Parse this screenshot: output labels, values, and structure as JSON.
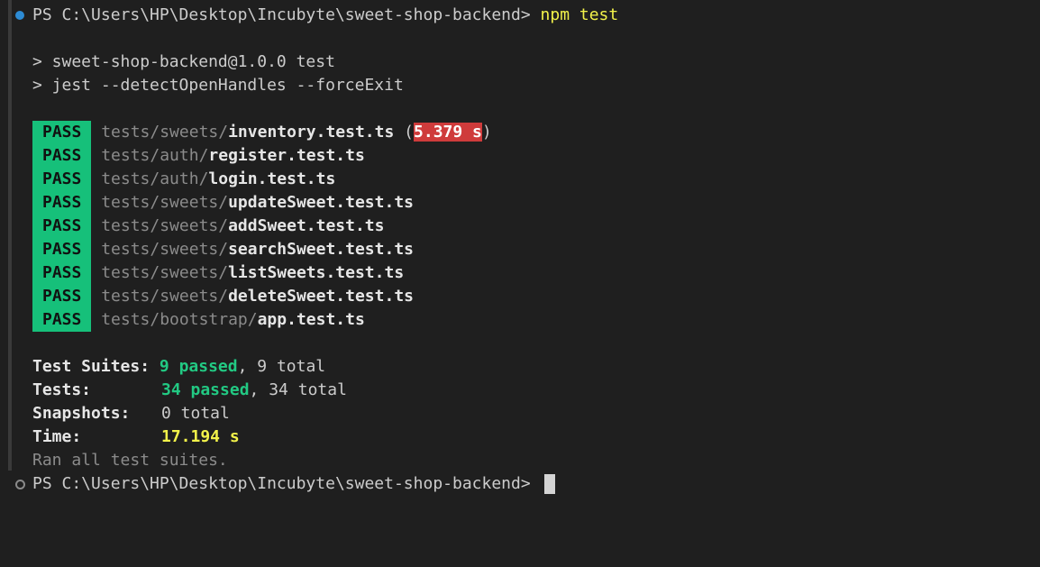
{
  "prompt1": {
    "path": "PS C:\\Users\\HP\\Desktop\\Incubyte\\sweet-shop-backend>",
    "command": "npm test"
  },
  "script_lines": [
    "> sweet-shop-backend@1.0.0 test",
    "> jest --detectOpenHandles --forceExit"
  ],
  "results": [
    {
      "status": "PASS",
      "dir": "tests/sweets/",
      "file": "inventory.test.ts",
      "open": " (",
      "time": "5.379 s",
      "close": ")"
    },
    {
      "status": "PASS",
      "dir": "tests/auth/",
      "file": "register.test.ts"
    },
    {
      "status": "PASS",
      "dir": "tests/auth/",
      "file": "login.test.ts"
    },
    {
      "status": "PASS",
      "dir": "tests/sweets/",
      "file": "updateSweet.test.ts"
    },
    {
      "status": "PASS",
      "dir": "tests/sweets/",
      "file": "addSweet.test.ts"
    },
    {
      "status": "PASS",
      "dir": "tests/sweets/",
      "file": "searchSweet.test.ts"
    },
    {
      "status": "PASS",
      "dir": "tests/sweets/",
      "file": "listSweets.test.ts"
    },
    {
      "status": "PASS",
      "dir": "tests/sweets/",
      "file": "deleteSweet.test.ts"
    },
    {
      "status": "PASS",
      "dir": "tests/bootstrap/",
      "file": "app.test.ts"
    }
  ],
  "summary": {
    "suites_label": "Test Suites:",
    "suites_passed": "9 passed",
    "suites_total": ", 9 total",
    "tests_label": "Tests:",
    "tests_passed": "34 passed",
    "tests_total": ", 34 total",
    "snapshots_label": "Snapshots:",
    "snapshots_value": "0 total",
    "time_label": "Time:",
    "time_value": "17.194 s",
    "ran_all": "Ran all test suites."
  },
  "prompt2": {
    "path": "PS C:\\Users\\HP\\Desktop\\Incubyte\\sweet-shop-backend>"
  },
  "colors": {
    "background": "#1f1f1f",
    "pass_badge": "#16c07a",
    "slow_time": "#cf3b3b",
    "passed_text": "#22c983",
    "time_text": "#f2f24a",
    "decoration_success": "#2d8bd4"
  }
}
